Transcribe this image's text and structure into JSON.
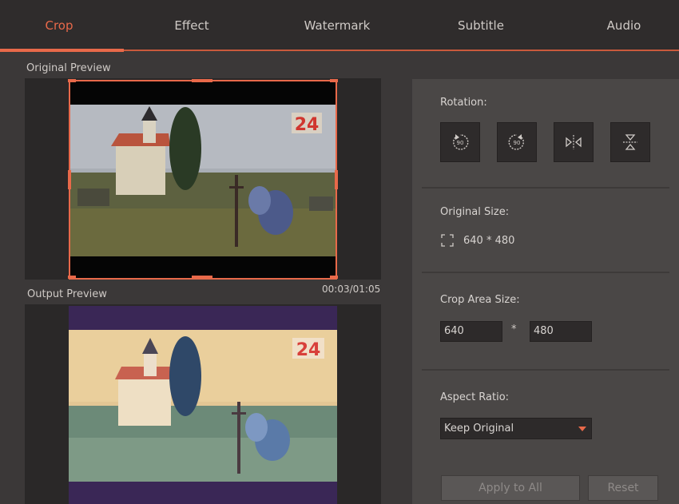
{
  "tabs": [
    {
      "label": "Crop",
      "active": true
    },
    {
      "label": "Effect",
      "active": false
    },
    {
      "label": "Watermark",
      "active": false
    },
    {
      "label": "Subtitle",
      "active": false
    },
    {
      "label": "Audio",
      "active": false
    }
  ],
  "preview": {
    "original_label": "Original Preview",
    "output_label": "Output Preview",
    "timecode": "00:03/01:05",
    "logo_text": "24"
  },
  "settings": {
    "rotation_label": "Rotation:",
    "rotation_buttons": [
      "rotate-left-icon",
      "rotate-right-icon",
      "flip-horizontal-icon",
      "flip-vertical-icon"
    ],
    "original_size_label": "Original Size:",
    "original_size_value": "640 * 480",
    "crop_area_label": "Crop Area Size:",
    "crop_width": "640",
    "crop_height": "480",
    "times_symbol": "*",
    "aspect_ratio_label": "Aspect Ratio:",
    "aspect_ratio_value": "Keep Original",
    "apply_all_label": "Apply to All",
    "reset_label": "Reset"
  },
  "colors": {
    "accent": "#e8694a",
    "output_bar": "#3a2756"
  }
}
